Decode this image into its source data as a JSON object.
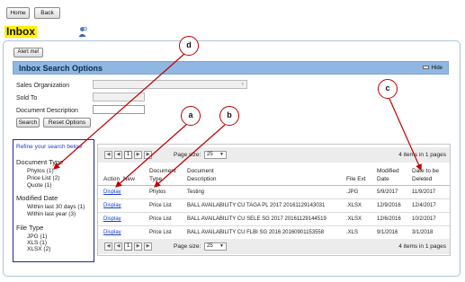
{
  "top_buttons": {
    "home": "Home",
    "back": "Back"
  },
  "page_title": "Inbox",
  "alert_button": "Alert me!",
  "search_options": {
    "title": "Inbox Search Options",
    "hide_label": "Hide",
    "sales_org_label": "Sales Organization",
    "sold_to_label": "Sold To",
    "doc_desc_label": "Document Description",
    "search_label": "Search",
    "reset_label": "Reset Options"
  },
  "refine": {
    "heading": "Refine your search below",
    "doc_type_label": "Document Type",
    "doc_types": [
      "Phytos (1)",
      "Price List (2)",
      "Quote (1)"
    ],
    "modified_label": "Modified Date",
    "modified_opts": [
      "Within last 30 days (1)",
      "Within last year (3)"
    ],
    "file_type_label": "File Type",
    "file_types": [
      "JPG (1)",
      "XLS (1)",
      "XLSX (2)"
    ]
  },
  "grid": {
    "page_number": "1",
    "page_size_label": "Page size:",
    "page_size_value": "25",
    "items_info": "4 items in 1 pages",
    "headers": {
      "action": "Action",
      "new": "New",
      "doc_type_l1": "Document",
      "doc_type_l2": "Type",
      "doc_desc_l1": "Document",
      "doc_desc_l2": "Description",
      "file_ext": "File Ext",
      "modified_l1": "Modified",
      "modified_l2": "Date",
      "delete_l1": "Date to be",
      "delete_l2": "Deleted"
    },
    "rows": [
      {
        "action": "Display",
        "type": "Phytos",
        "desc": "Testing",
        "ext": ".JPG",
        "modified": "5/9/2017",
        "delete": "11/9/2017"
      },
      {
        "action": "Display",
        "type": "Price List",
        "desc": "BALL AVAILABILITY CU TAGA PL 2017 20161129143031",
        "ext": ".XLSX",
        "modified": "12/9/2016",
        "delete": "12/4/2017"
      },
      {
        "action": "Display",
        "type": "Price List",
        "desc": "BALL AVAILABILITY CU SELE SG 2017 20161129144519",
        "ext": ".XLSX",
        "modified": "12/6/2016",
        "delete": "10/2/2017"
      },
      {
        "action": "Display",
        "type": "Price List",
        "desc": "BALL AVAILABILITY CU FLBI SG 2016 20160901153558",
        "ext": ".XLS",
        "modified": "9/1/2016",
        "delete": "3/1/2018"
      }
    ]
  },
  "callouts": {
    "a": "a",
    "b": "b",
    "c": "c",
    "d": "d"
  },
  "colors": {
    "highlight": "#fff200",
    "header_blue": "#8fb7e2",
    "annotation_red": "#c00000",
    "link_blue": "#1a3ec7"
  },
  "icons": {
    "help": "help-person-icon",
    "hide": "hide-icon"
  }
}
